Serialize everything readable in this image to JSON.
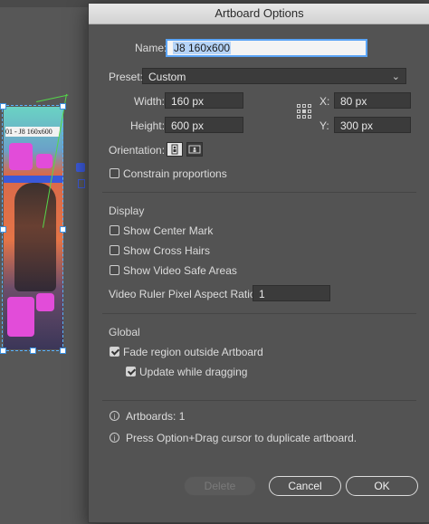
{
  "artboard": {
    "tag": "01 - J8 160x600"
  },
  "dialog": {
    "title": "Artboard Options",
    "name": {
      "label": "Name:",
      "value": "J8 160x600"
    },
    "preset": {
      "label": "Preset:",
      "value": "Custom"
    },
    "width": {
      "label": "Width:",
      "value": "160 px"
    },
    "height": {
      "label": "Height:",
      "value": "600 px"
    },
    "x": {
      "label": "X:",
      "value": "80 px"
    },
    "y": {
      "label": "Y:",
      "value": "300 px"
    },
    "orientation": {
      "label": "Orientation:",
      "selected": "portrait"
    },
    "constrain": {
      "label": "Constrain proportions",
      "checked": false
    },
    "display": {
      "title": "Display",
      "center_mark": {
        "label": "Show Center Mark",
        "checked": false
      },
      "cross_hairs": {
        "label": "Show Cross Hairs",
        "checked": false
      },
      "video_safe": {
        "label": "Show Video Safe Areas",
        "checked": false
      },
      "pixel_ratio": {
        "label": "Video Ruler Pixel Aspect Ratio:",
        "value": "1"
      }
    },
    "global": {
      "title": "Global",
      "fade": {
        "label": "Fade region outside Artboard",
        "checked": true
      },
      "update": {
        "label": "Update while dragging",
        "checked": true
      }
    },
    "info": {
      "artboards": "Artboards: 1",
      "tip": "Press Option+Drag cursor to duplicate artboard."
    },
    "buttons": {
      "delete": "Delete",
      "cancel": "Cancel",
      "ok": "OK"
    }
  }
}
